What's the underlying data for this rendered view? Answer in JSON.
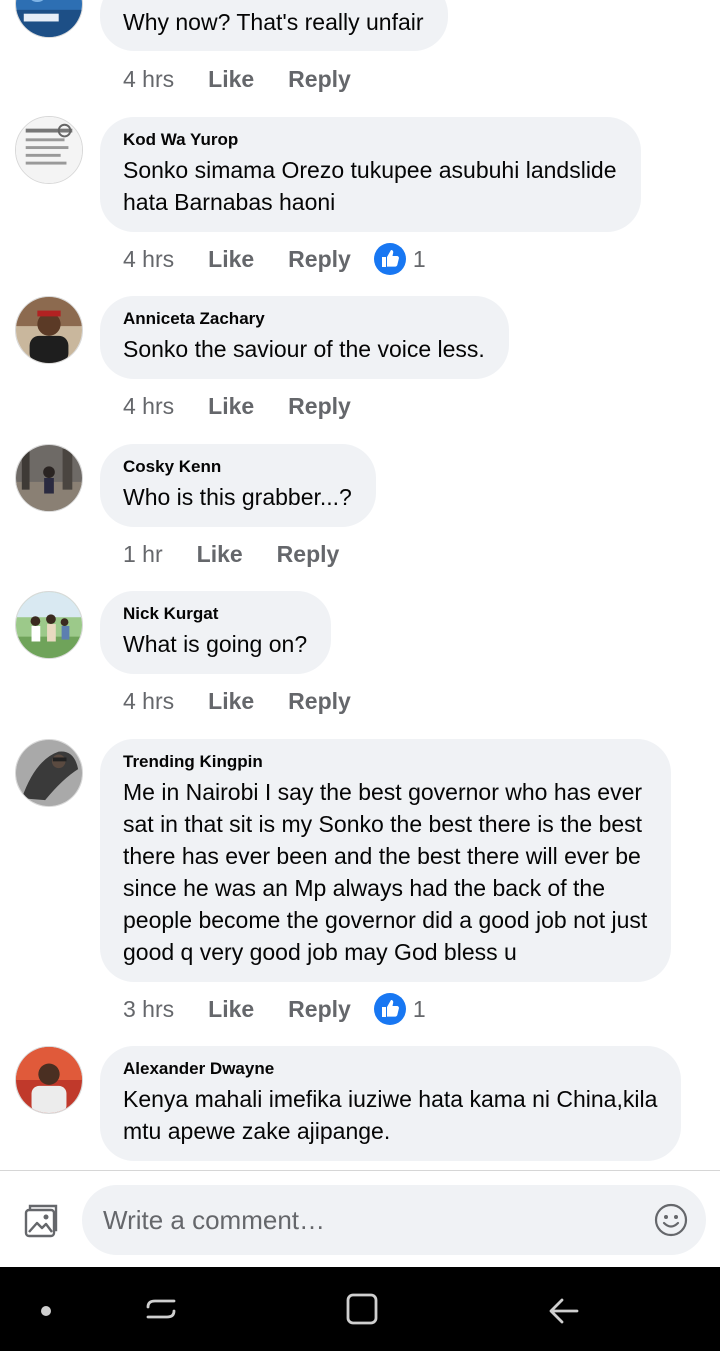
{
  "colors": {
    "bubble": "#f0f2f5",
    "meta_text": "#65676b",
    "like_blue": "#1877f2",
    "navbar": "#000000"
  },
  "actions": {
    "like": "Like",
    "reply": "Reply"
  },
  "comments": [
    {
      "author": "",
      "text": "Why now? That's really unfair",
      "time": "4 hrs",
      "likes": ""
    },
    {
      "author": "Kod Wa Yurop",
      "text": "Sonko simama Orezo tukupee asubuhi landslide\nhata Barnabas haoni",
      "time": "4 hrs",
      "likes": "1"
    },
    {
      "author": "Anniceta Zachary",
      "text": "Sonko the saviour of the voice less.",
      "time": "4 hrs",
      "likes": ""
    },
    {
      "author": "Cosky Kenn",
      "text": "Who is this grabber...?",
      "time": "1 hr",
      "likes": ""
    },
    {
      "author": "Nick Kurgat",
      "text": "What is going on?",
      "time": "4 hrs",
      "likes": ""
    },
    {
      "author": "Trending Kingpin",
      "text": "Me in Nairobi I say the best governor who has ever\nsat in that sit is my Sonko the best there is the best\nthere has ever been and the best there will ever be\nsince he was an Mp always had the back of the\npeople become the governor did a good job not just\ngood q very good job may God bless u",
      "time": "3 hrs",
      "likes": "1"
    },
    {
      "author": "Alexander Dwayne",
      "text": "Kenya mahali imefika iuziwe hata kama ni China,kila\nmtu apewe zake ajipange.",
      "time": "",
      "likes": ""
    }
  ],
  "composer": {
    "placeholder": "Write a comment…",
    "photo_icon": "photo-icon",
    "emoji_icon": "smiley-icon"
  },
  "navbar": {
    "icons": [
      "dot-icon",
      "recent-apps-icon",
      "home-icon",
      "back-icon"
    ]
  }
}
